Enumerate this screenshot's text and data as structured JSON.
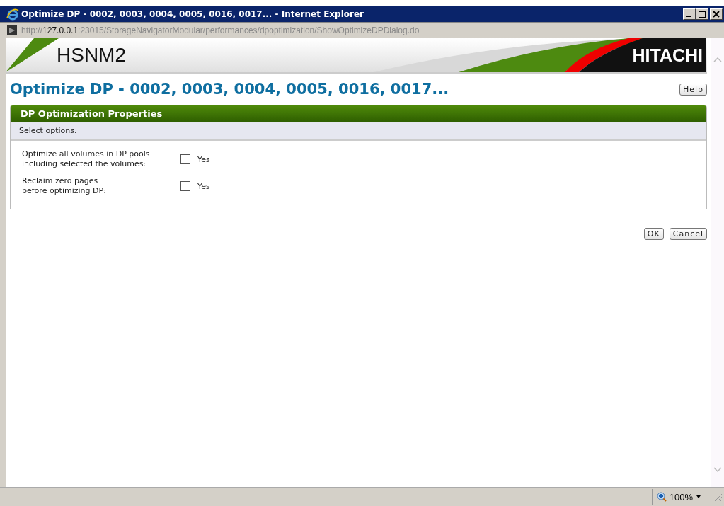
{
  "window": {
    "title": "Optimize DP - 0002, 0003, 0004, 0005, 0016, 0017... - Internet Explorer"
  },
  "address": {
    "scheme": "http://",
    "host": "127.0.0.1",
    "rest": ":23015/StorageNavigatorModular/performances/dpoptimization/ShowOptimizeDPDialog.do"
  },
  "banner": {
    "product": "HSNM2",
    "brand": "HITACHI"
  },
  "page": {
    "heading": "Optimize DP - 0002, 0003, 0004, 0005, 0016, 0017...",
    "help": "Help"
  },
  "panel": {
    "title": "DP Optimization Properties",
    "instruction": "Select options.",
    "options": [
      {
        "label_lines": [
          "Optimize all volumes in DP pools",
          "including selected the volumes:"
        ],
        "checkbox_label": "Yes",
        "checked": false
      },
      {
        "label_lines": [
          "Reclaim zero pages",
          "before optimizing DP:"
        ],
        "checkbox_label": "Yes",
        "checked": false
      }
    ]
  },
  "buttons": [
    "OK",
    "Cancel"
  ],
  "status_bar": {
    "zoom": "100%"
  }
}
